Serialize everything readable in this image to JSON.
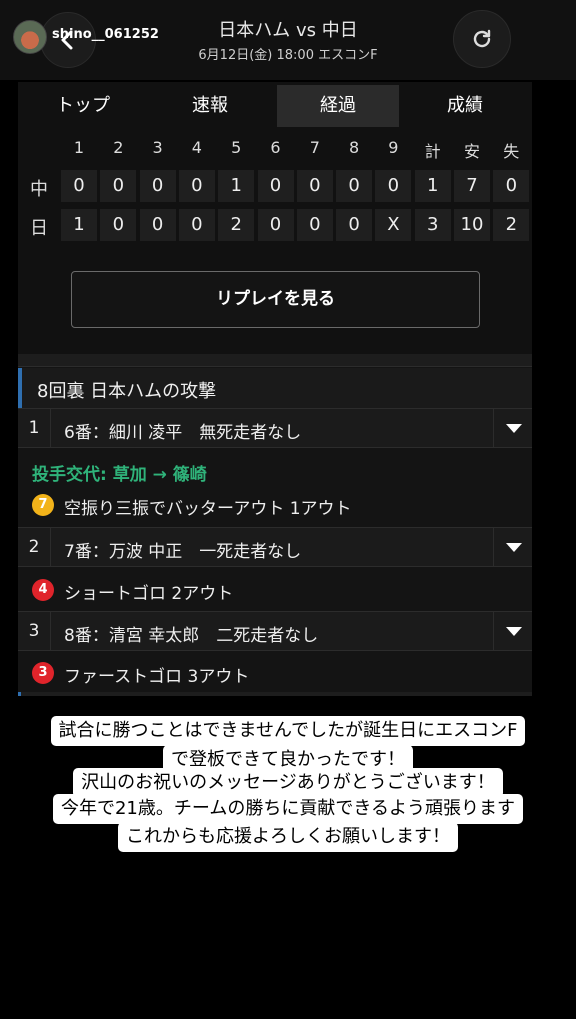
{
  "header": {
    "username": "shino__061252",
    "title": "日本ハム vs 中日",
    "subtitle": "6月12日(金) 18:00 エスコンF"
  },
  "tabs": [
    "トップ",
    "速報",
    "経過",
    "成績"
  ],
  "active_tab": "経過",
  "scoreboard": {
    "headers": [
      "1",
      "2",
      "3",
      "4",
      "5",
      "6",
      "7",
      "8",
      "9",
      "計",
      "安",
      "失"
    ],
    "teams": [
      {
        "name": "中",
        "cells": [
          "0",
          "0",
          "0",
          "0",
          "1",
          "0",
          "0",
          "0",
          "0",
          "1",
          "7",
          "0"
        ]
      },
      {
        "name": "日",
        "cells": [
          "1",
          "0",
          "0",
          "0",
          "2",
          "0",
          "0",
          "0",
          "X",
          "3",
          "10",
          "2"
        ]
      }
    ]
  },
  "replay_label": "リプレイを見る",
  "inning_header": "8回裏 日本ハムの攻撃",
  "pitcher_change": "投手交代: 草加 → 篠崎",
  "at_bats": [
    {
      "num": "1",
      "text": "6番：細川 凌平　無死走者なし"
    },
    {
      "num": "2",
      "text": "7番：万波 中正　一死走者なし"
    },
    {
      "num": "3",
      "text": "8番：清宮 幸太郎　二死走者なし"
    }
  ],
  "plays": [
    {
      "badge": "7",
      "text": "空振り三振でバッターアウト 1アウト",
      "color": "#f2b31a"
    },
    {
      "badge": "4",
      "text": "ショートゴロ 2アウト",
      "color": "#e0242b"
    },
    {
      "badge": "3",
      "text": "ファーストゴロ 3アウト",
      "color": "#e0242b"
    }
  ],
  "caption": [
    "試合に勝つことはできませんでしたが誕生日にエスコンF",
    "で登板できて良かったです！",
    "沢山のお祝いのメッセージありがとうございます！",
    "今年で21歳。チームの勝ちに貢献できるよう頑張ります",
    "これからも応援よろしくお願いします！"
  ],
  "icons": {
    "back": "back-chevron-icon",
    "refresh": "refresh-icon"
  }
}
